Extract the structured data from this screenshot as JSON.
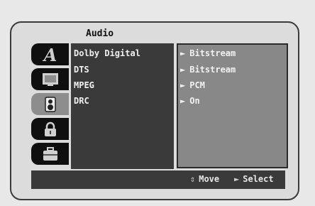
{
  "title": "Audio",
  "tabs": [
    {
      "name": "language",
      "active": false
    },
    {
      "name": "display",
      "active": false
    },
    {
      "name": "audio",
      "active": true
    },
    {
      "name": "lock",
      "active": false
    },
    {
      "name": "others",
      "active": false
    }
  ],
  "rows": [
    {
      "label": "Dolby Digital",
      "value": "Bitstream"
    },
    {
      "label": "DTS",
      "value": "Bitstream"
    },
    {
      "label": "MPEG",
      "value": "PCM"
    },
    {
      "label": "DRC",
      "value": "On"
    }
  ],
  "tab_letter": "A",
  "value_arrow": "►",
  "hints": {
    "move_icon": "⇕",
    "move_label": "Move",
    "select_icon": "►",
    "select_label": "Select"
  }
}
